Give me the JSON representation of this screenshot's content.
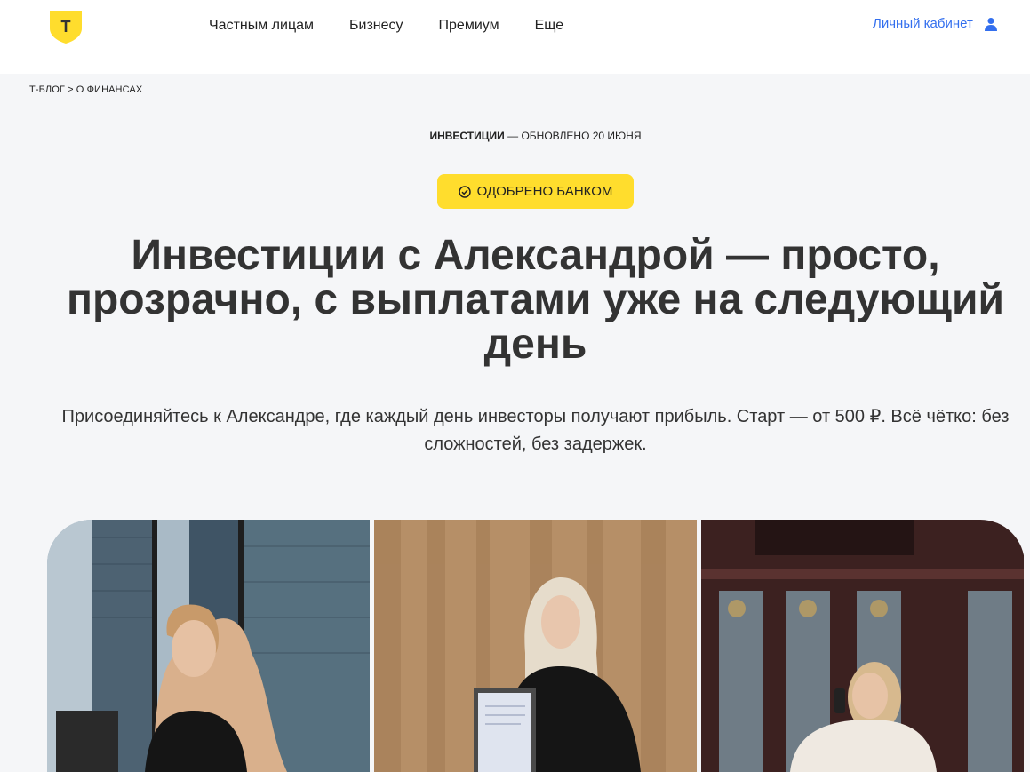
{
  "header": {
    "logo_letter": "Т",
    "nav": [
      "Частным лицам",
      "Бизнесу",
      "Премиум",
      "Еще"
    ],
    "cabinet_label": "Личный кабинет",
    "cabinet_icon": "user-icon"
  },
  "breadcrumb": {
    "root": "Т-БЛОГ",
    "separator": ">",
    "current": "О ФИНАНСАХ"
  },
  "meta": {
    "category": "ИНВЕСТИЦИИ",
    "updated": "— ОБНОВЛЕНО 20 ИЮНЯ"
  },
  "badge": {
    "label": "ОДОБРЕНО БАНКОМ",
    "icon": "check-circle-icon"
  },
  "title": "Инвестиции с Александрой — просто, прозрачно, с выплатами уже на следующий день",
  "lead": "Присоединяйтесь к Александре, где каждый день инвесторы получают прибыль. Старт — от 500 ₽. Всё чётко: без сложностей, без задержек.",
  "colors": {
    "brand_yellow": "#ffdd2d",
    "link_blue": "#336fee",
    "background": "#f5f6f8"
  }
}
